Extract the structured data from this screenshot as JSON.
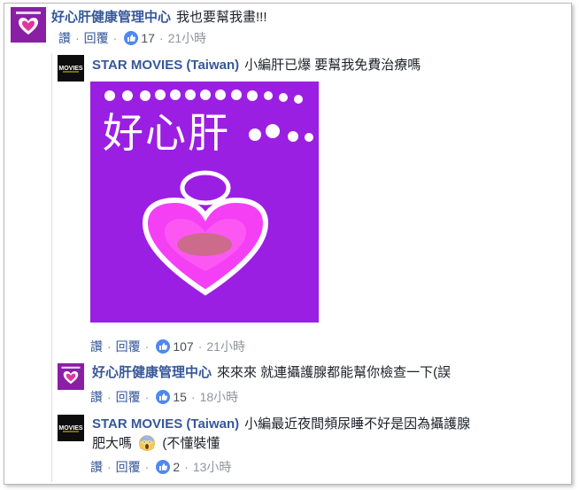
{
  "comments": [
    {
      "author": "好心肝健康管理中心",
      "text": "我也要幫我畫!!!",
      "actions": {
        "like": "讚",
        "reply": "回覆",
        "likes": "17",
        "time": "21小時"
      }
    },
    {
      "author": "STAR MOVIES (Taiwan)",
      "text": "小編肝已爆 要幫我免費治療嗎",
      "image_caption": "好心肝",
      "actions": {
        "like": "讚",
        "reply": "回覆",
        "likes": "107",
        "time": "21小時"
      }
    },
    {
      "author": "好心肝健康管理中心",
      "text": "來來來 就連攝護腺都能幫你檢查一下(誤",
      "actions": {
        "like": "讚",
        "reply": "回覆",
        "likes": "15",
        "time": "18小時"
      }
    },
    {
      "author": "STAR MOVIES (Taiwan)",
      "text_line1": "小編最近夜間頻尿睡不好是因為攝護腺",
      "text_line2_before": "肥大嗎",
      "text_line2_after": "(不懂裝懂",
      "actions": {
        "like": "讚",
        "reply": "回覆",
        "likes": "2",
        "time": "13小時"
      }
    }
  ],
  "colors": {
    "link": "#365899",
    "meta": "#90949c",
    "like_blue": "#4f88f0",
    "image_purple": "#9b1fe3",
    "heart_pink": "#f53ff5"
  },
  "icons": [
    "hospital-logo-avatar",
    "star-movies-avatar",
    "thumbs-up-icon",
    "scream-emoji-icon"
  ]
}
